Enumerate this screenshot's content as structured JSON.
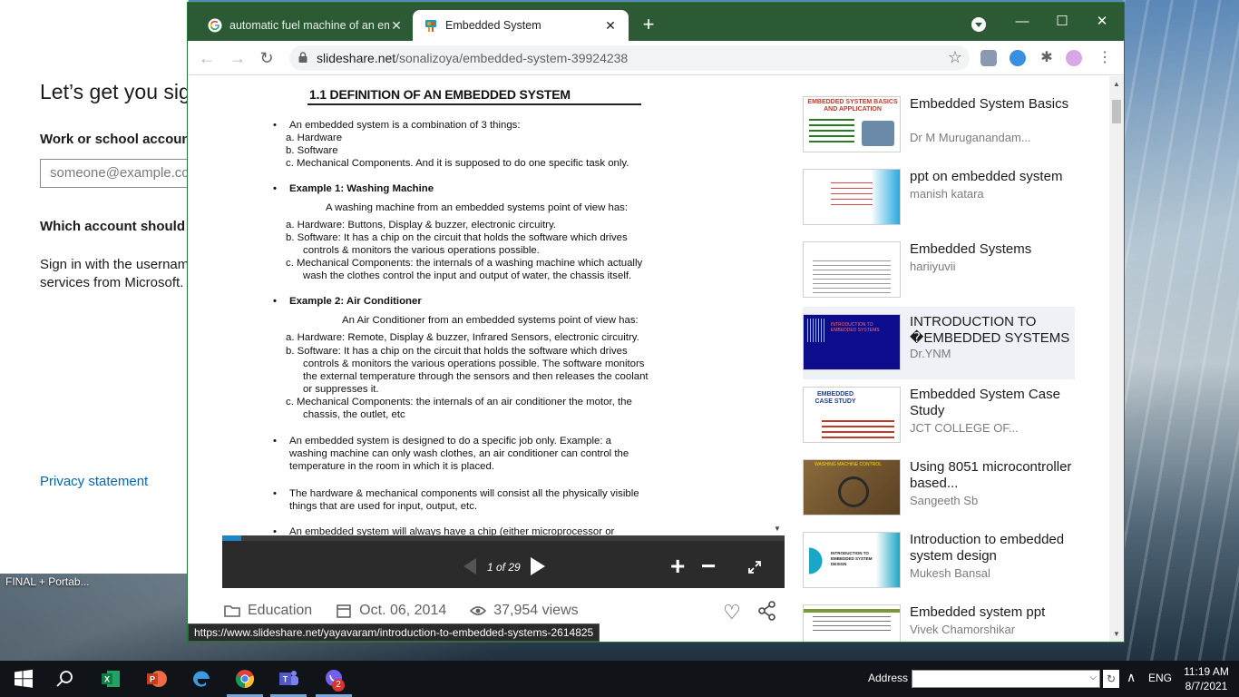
{
  "desktop": {
    "signin": {
      "heading": "Let’s get you sig",
      "work_label": "Work or school account",
      "email_placeholder": "someone@example.co",
      "which_label": "Which account should I",
      "desc_line1": "Sign in with the usernam",
      "desc_line2": "services from Microsoft.",
      "privacy": "Privacy statement"
    },
    "desktop_label": "FINAL + Portab..."
  },
  "browser": {
    "tabs": [
      {
        "title": "automatic fuel machine of an em",
        "icon": "google-icon"
      },
      {
        "title": "Embedded System",
        "icon": "slideshare-icon"
      }
    ],
    "url_domain": "slideshare.net",
    "url_path": "/sonalizoya/embedded-system-39924238",
    "status_url": "https://www.slideshare.net/yayavaram/introduction-to-embedded-systems-2614825"
  },
  "document": {
    "title": "1.1 DEFINITION OF AN EMBEDDED SYSTEM",
    "lines": {
      "l1": "An embedded system is a combination of 3 things:",
      "l2": "a.  Hardware",
      "l3": "b.  Software",
      "l4": "c.  Mechanical Components. And it is supposed to do one specific task only.",
      "ex1": "Example 1: Washing Machine",
      "ex1_intro": "A washing machine from an embedded systems point of view has:",
      "ex1_a": "a.  Hardware: Buttons, Display & buzzer, electronic circuitry.",
      "ex1_b1": "b.  Software: It has a chip on the circuit that holds the software which drives",
      "ex1_b2": "controls & monitors the various operations possible.",
      "ex1_c1": "c.  Mechanical Components: the internals of a washing machine which actually",
      "ex1_c2": "wash the clothes control the input and output of water, the chassis itself.",
      "ex2": "Example 2: Air Conditioner",
      "ex2_intro": "An Air Conditioner from an embedded systems point of view has:",
      "ex2_a": "a.  Hardware: Remote, Display & buzzer, Infrared Sensors, electronic circuitry.",
      "ex2_b1": "b.  Software: It has a chip on the circuit that holds the software which drives",
      "ex2_b2": "controls & monitors the various operations possible. The software monitors",
      "ex2_b3": "the external temperature through the sensors and then releases the coolant",
      "ex2_b4": "or suppresses it.",
      "ex2_c1": "c.  Mechanical Components: the internals of an air conditioner the motor, the",
      "ex2_c2": "chassis, the outlet, etc",
      "p1a": "An embedded system is designed to do a specific job only. Example: a",
      "p1b": "washing machine can only wash clothes, an air conditioner can control the",
      "p1c": "temperature in the room in which it is placed.",
      "p2a": "The hardware & mechanical components will consist all the physically visible",
      "p2b": "things that are used for input, output, etc.",
      "p3a": "An embedded system will always have a chip (either microprocessor or"
    }
  },
  "viewer": {
    "page_indicator": "1 of 29",
    "progress_fraction": 0.0345
  },
  "meta": {
    "category": "Education",
    "date": "Oct. 06, 2014",
    "views": "37,954 views"
  },
  "related": [
    {
      "title": "Embedded System Basics",
      "author": "Dr M Muruganandam...",
      "thumb_text": "EMBEDDED SYSTEM BASICS AND APPLICATION"
    },
    {
      "title": "ppt on embedded system",
      "author": "manish katara",
      "thumb_text": ""
    },
    {
      "title": "Embedded Systems",
      "author": "hariiyuvii",
      "thumb_text": ""
    },
    {
      "title": "INTRODUCTION TO �EMBEDDED SYSTEMS",
      "author": "Dr.YNM",
      "thumb_text": "INTRODUCTION TO EMBEDDED SYSTEMS"
    },
    {
      "title": "Embedded System Case Study",
      "author": "JCT COLLEGE OF...",
      "thumb_text": "EMBEDDED CASE STUDY"
    },
    {
      "title": "Using 8051 microcontroller based...",
      "author": "Sangeeth Sb",
      "thumb_text": "WASHING MACHINE CONTROL"
    },
    {
      "title": "Introduction to embedded system design",
      "author": "Mukesh Bansal",
      "thumb_text": "INTRODUCTION TO EMBEDDED SYSTEM DESIGN"
    },
    {
      "title": "Embedded system ppt",
      "author": "Vivek Chamorshikar",
      "thumb_text": ""
    }
  ],
  "taskbar": {
    "address_label": "Address",
    "language": "ENG",
    "time": "11:19 AM",
    "date": "8/7/2021",
    "viber_badge": "2"
  },
  "colors": {
    "chrome_frame": "#2b5a35",
    "link_blue": "#0067b8",
    "viewer_bg": "#2b2b2b",
    "progress_blue": "#1f86c6"
  }
}
